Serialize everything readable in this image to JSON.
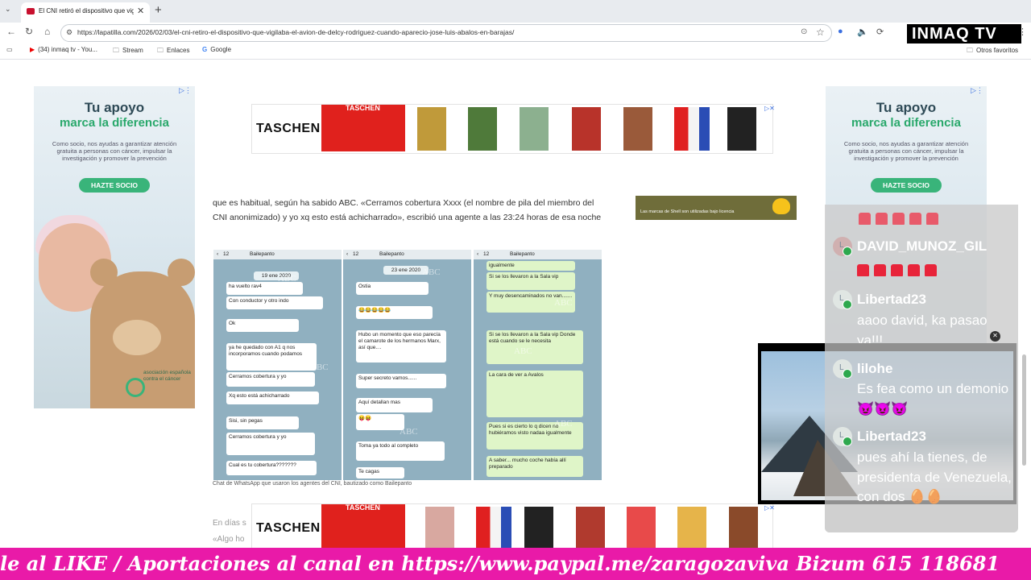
{
  "browser": {
    "tab_title": "El CNI retiró el dispositivo que vigilaba el avión de Delcy",
    "url": "https://lapatilla.com/2026/02/03/el-cni-retiro-el-dispositivo-que-vigilaba-el-avion-de-delcy-rodriguez-cuando-aparecio-jose-luis-abalos-en-barajas/",
    "bookmarks": [
      "(34) inmaq tv - You...",
      "Stream",
      "Enlaces",
      "Google"
    ],
    "other_bookmarks": "Otros favoritos"
  },
  "channel_logo": "INMAQ TV",
  "side_ad": {
    "line1": "Tu apoyo",
    "line2": "marca la diferencia",
    "body": "Como socio, nos ayudas a garantizar atención gratuita a personas con cáncer, impulsar la investigación y promover la prevención",
    "button": "HAZTE SOCIO",
    "org": "asociación española contra el cáncer"
  },
  "banner": {
    "brand": "TASCHEN",
    "red_label": "TASCHEN"
  },
  "article": {
    "paragraph": "que es habitual, según ha sabido ABC. «Cerramos cobertura Xxxx (el nombre de pila del miembro del CNI anonimizado) y yo xq esto está achicharrado», escribió una agente a las 23:24 horas de esa noche",
    "caption": "Chat de WhatsApp que usaron los agentes del CNI, bautizado como Bailepanto",
    "faded1": "En días s",
    "faded2": "«Algo ho"
  },
  "shell_ad": "Las marcas de Shell son utilizadas bajo licencia",
  "chat_shots": {
    "header": "Bailepanto",
    "back": "12",
    "shot1": [
      "19 ene 2020",
      "ha vuelto rav4",
      "Con conductor y otro indo",
      "Ok",
      "ya he quedado con A1 q nos incorporamos cuando podamos",
      "Cerramos cobertura y yo",
      "Xq esto está achicharrado",
      "Sisi, sin pegas",
      "Cerramos cobertura y yo",
      "Cual es tu cobertura???????"
    ],
    "shot2": [
      "23 ene 2020",
      "Ostia",
      "Hubo un momento que eso parecía el camarote de los hermanos Marx, así que....",
      "Super secreto vamos......",
      "Aquí detallan mas",
      "Toma ya todo al completo",
      "Te cagas"
    ],
    "shot3": [
      "igualmente",
      "Si se los llevaron a la Sala vip",
      "Y muy desencaminados no van.......",
      "Si se los llevaron a la Sala vip Donde está cuando se le necesita",
      "La cara de ver a Avalos",
      "Pues si es cierto lo q dicen no hubiéramos visto nadaa igualmente",
      "A saber... mucho coche había allí preparado"
    ],
    "watermark": "ABC"
  },
  "live_chat": [
    {
      "user": "DAVID_MUNOZ_GIL",
      "message": ""
    },
    {
      "user": "Libertad23",
      "message": "aaoo david, ka pasao ya!!!"
    },
    {
      "user": "lilohe",
      "message": "Es fea como un demonio 😈😈😈"
    },
    {
      "user": "Libertad23",
      "message": "pues ahí la tienes, de presidenta de Venezuela, con dos 🥚🥚"
    }
  ],
  "ticker": "le al LIKE / Aportaciones al canal en https://www.paypal.me/zaragozaviva Bizum 615 118681",
  "colors": {
    "ticker_bg": "#e91aa8",
    "logo_bg": "#000000",
    "ad_green": "#29a86b",
    "taschen_red": "#e0211d"
  }
}
